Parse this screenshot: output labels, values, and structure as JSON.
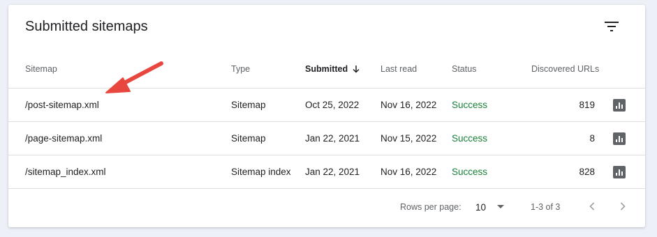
{
  "card": {
    "title": "Submitted sitemaps",
    "filter_icon": "filter-list-icon"
  },
  "table": {
    "columns": [
      {
        "label": "Sitemap"
      },
      {
        "label": "Type"
      },
      {
        "label": "Submitted",
        "sorted": "descending"
      },
      {
        "label": "Last read"
      },
      {
        "label": "Status"
      },
      {
        "label": "Discovered URLs"
      }
    ],
    "rows": [
      {
        "sitemap": "/post-sitemap.xml",
        "type": "Sitemap",
        "submitted": "Oct 25, 2022",
        "last_read": "Nov 16, 2022",
        "status": "Success",
        "discovered_urls": "819"
      },
      {
        "sitemap": "/page-sitemap.xml",
        "type": "Sitemap",
        "submitted": "Jan 22, 2021",
        "last_read": "Nov 15, 2022",
        "status": "Success",
        "discovered_urls": "8"
      },
      {
        "sitemap": "/sitemap_index.xml",
        "type": "Sitemap index",
        "submitted": "Jan 22, 2021",
        "last_read": "Nov 16, 2022",
        "status": "Success",
        "discovered_urls": "828"
      }
    ],
    "row_action_icon": "bar-chart-icon"
  },
  "pagination": {
    "rows_per_page_label": "Rows per page:",
    "rows_per_page_value": "10",
    "range_text": "1-3 of 3",
    "prev_icon": "chevron-left-icon",
    "next_icon": "chevron-right-icon"
  },
  "annotation": {
    "icon": "red-arrow-icon",
    "color": "#e8473f"
  },
  "colors": {
    "success": "#188038",
    "background": "#eef0f8",
    "icon_gray": "#5f6368"
  }
}
